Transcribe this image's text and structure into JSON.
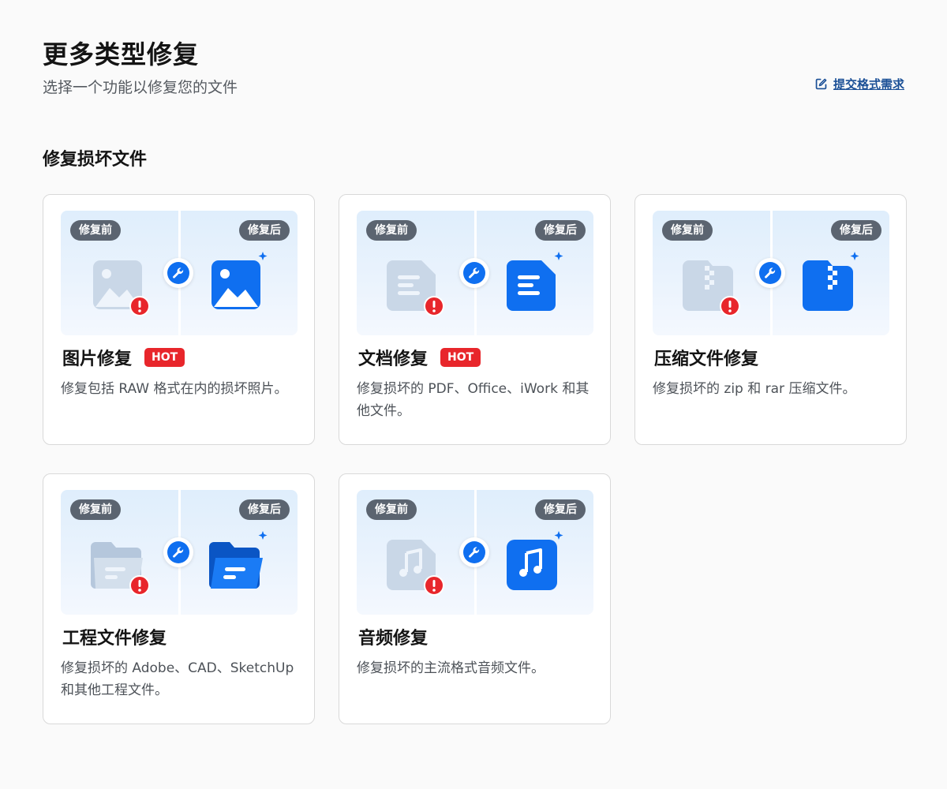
{
  "header": {
    "title": "更多类型修复",
    "subtitle": "选择一个功能以修复您的文件",
    "submit_link": "提交格式需求",
    "submit_icon": "edit-icon"
  },
  "section": {
    "title": "修复损坏文件"
  },
  "labels": {
    "before": "修复前",
    "after": "修复后"
  },
  "colors": {
    "accent": "#1a4f96",
    "hot": "#e8262b",
    "icon_blue": "#0f6ff0",
    "error_red": "#e8262b",
    "pill_bg": "#5b6470"
  },
  "cards": [
    {
      "title": "图片修复",
      "badge": "HOT",
      "description": "修复包括 RAW 格式在内的损坏照片。",
      "icon": "image-icon"
    },
    {
      "title": "文档修复",
      "badge": "HOT",
      "description": "修复损坏的 PDF、Office、iWork 和其他文件。",
      "icon": "document-icon"
    },
    {
      "title": "压缩文件修复",
      "badge": "",
      "description": "修复损坏的 zip 和 rar 压缩文件。",
      "icon": "zip-file-icon"
    },
    {
      "title": "工程文件修复",
      "badge": "",
      "description": "修复损坏的 Adobe、CAD、SketchUp 和其他工程文件。",
      "icon": "folder-icon"
    },
    {
      "title": "音频修复",
      "badge": "",
      "description": "修复损坏的主流格式音频文件。",
      "icon": "music-icon"
    }
  ]
}
